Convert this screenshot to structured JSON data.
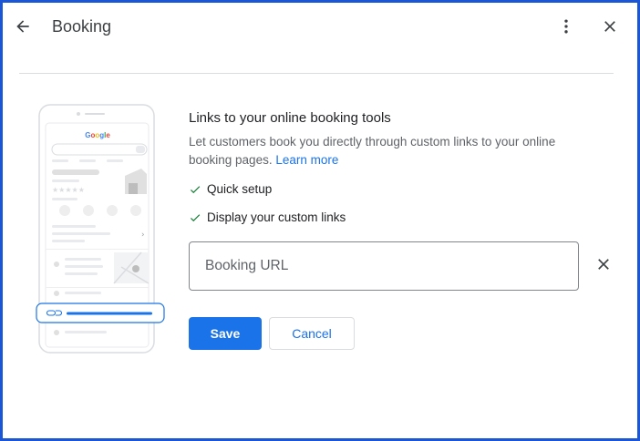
{
  "header": {
    "title": "Booking"
  },
  "illustration": {
    "brand": "Google"
  },
  "main": {
    "heading": "Links to your online booking tools",
    "description": "Let customers book you directly through custom links to your online booking pages.",
    "learn_more": "Learn more",
    "features": [
      "Quick setup",
      "Display your custom links"
    ]
  },
  "form": {
    "url_placeholder": "Booking URL"
  },
  "actions": {
    "save_label": "Save",
    "cancel_label": "Cancel"
  },
  "colors": {
    "accent": "#1a73e8",
    "frame": "#1a56d6",
    "check": "#188038"
  }
}
